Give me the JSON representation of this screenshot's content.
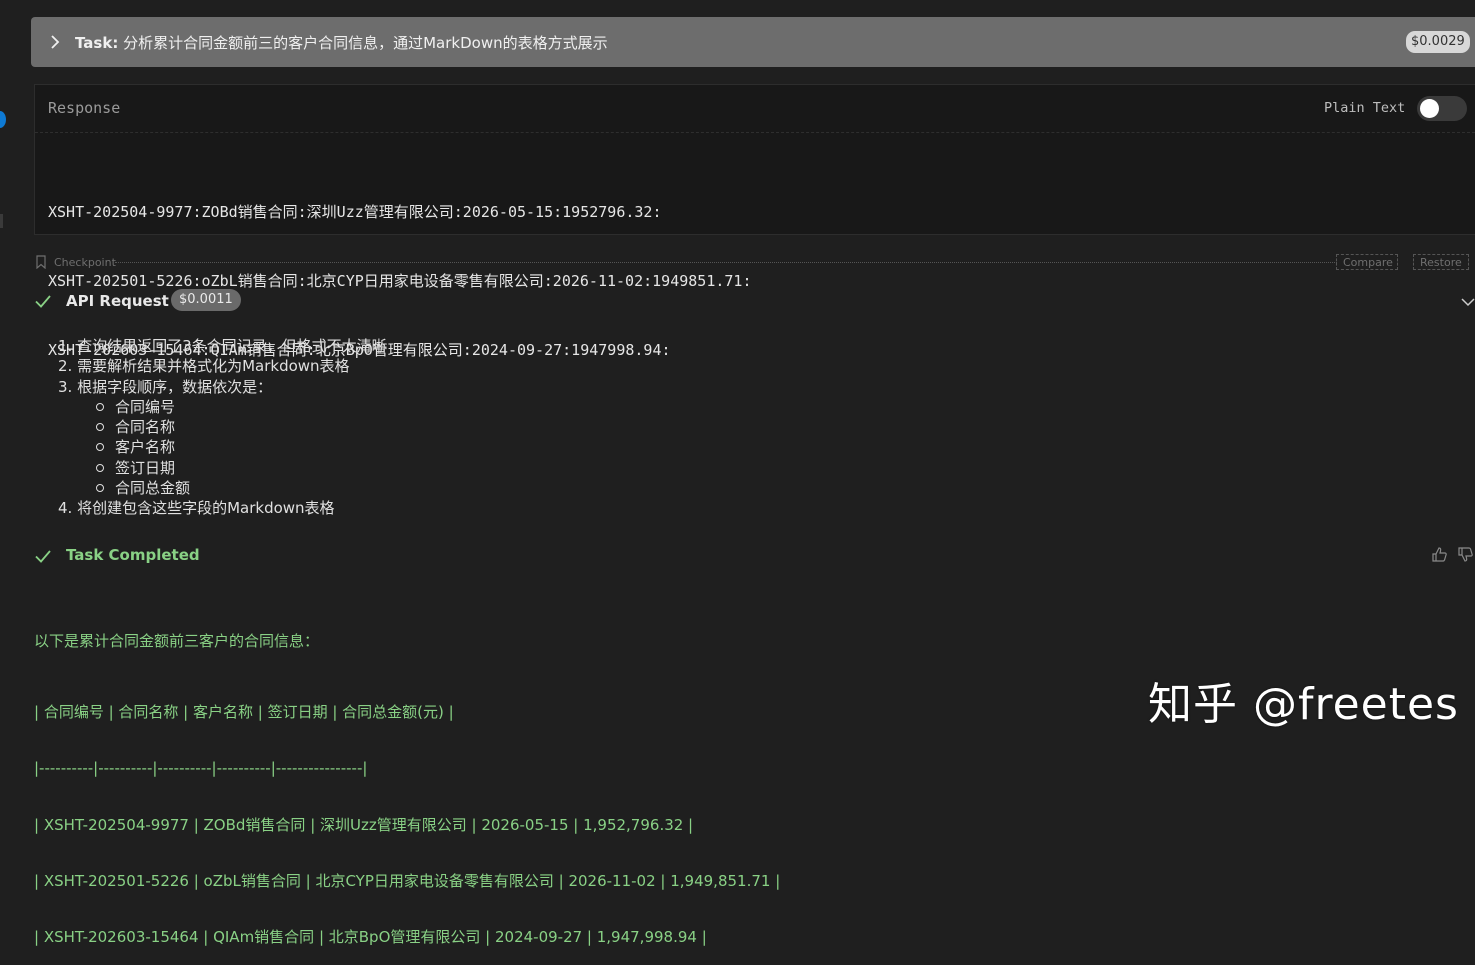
{
  "task": {
    "label": "Task:",
    "text": "分析累计合同金额前三的客户合同信息，通过MarkDown的表格方式展示",
    "cost": "$0.0029"
  },
  "response": {
    "title": "Response",
    "plain_text_label": "Plain Text",
    "plain_text_enabled": false,
    "lines": [
      "XSHT-202504-9977:ZOBd销售合同:深圳Uzz管理有限公司:2026-05-15:1952796.32:",
      "XSHT-202501-5226:oZbL销售合同:北京CYP日用家电设备零售有限公司:2026-11-02:1949851.71:",
      "XSHT-202603-15464:QIAm销售合同:北京BpO管理有限公司:2024-09-27:1947998.94:"
    ]
  },
  "checkpoint": {
    "label": "Checkpoint",
    "compare_label": "Compare",
    "restore_label": "Restore"
  },
  "api_request": {
    "label": "API Request",
    "cost": "$0.0011",
    "steps": [
      "1. 查询结果返回了3条合同记录，但格式不太清晰",
      "2. 需要解析结果并格式化为Markdown表格",
      "3. 根据字段顺序，数据依次是："
    ],
    "fields": [
      "合同编号",
      "合同名称",
      "客户名称",
      "签订日期",
      "合同总金额"
    ],
    "final_step": "4. 将创建包含这些字段的Markdown表格"
  },
  "completion": {
    "label": "Task Completed",
    "intro": "以下是累计合同金额前三客户的合同信息：",
    "table_lines": [
      "| 合同编号 | 合同名称 | 客户名称 | 签订日期 | 合同总金额(元) |",
      "|----------|----------|----------|----------|----------------|",
      "| XSHT-202504-9977 | ZOBd销售合同 | 深圳Uzz管理有限公司 | 2026-05-15 | 1,952,796.32 |",
      "| XSHT-202501-5226 | oZbL销售合同 | 北京CYP日用家电设备零售有限公司 | 2026-11-02 | 1,949,851.71 |",
      "| XSHT-202603-15464 | QIAm销售合同 | 北京BpO管理有限公司 | 2024-09-27 | 1,947,998.94 |"
    ]
  },
  "watermark": "知乎 @freetes",
  "colors": {
    "background": "#1f1f1f",
    "task_header": "#6d6d6d",
    "success_green": "#89d185",
    "accent_blue": "#0e7ad4"
  }
}
